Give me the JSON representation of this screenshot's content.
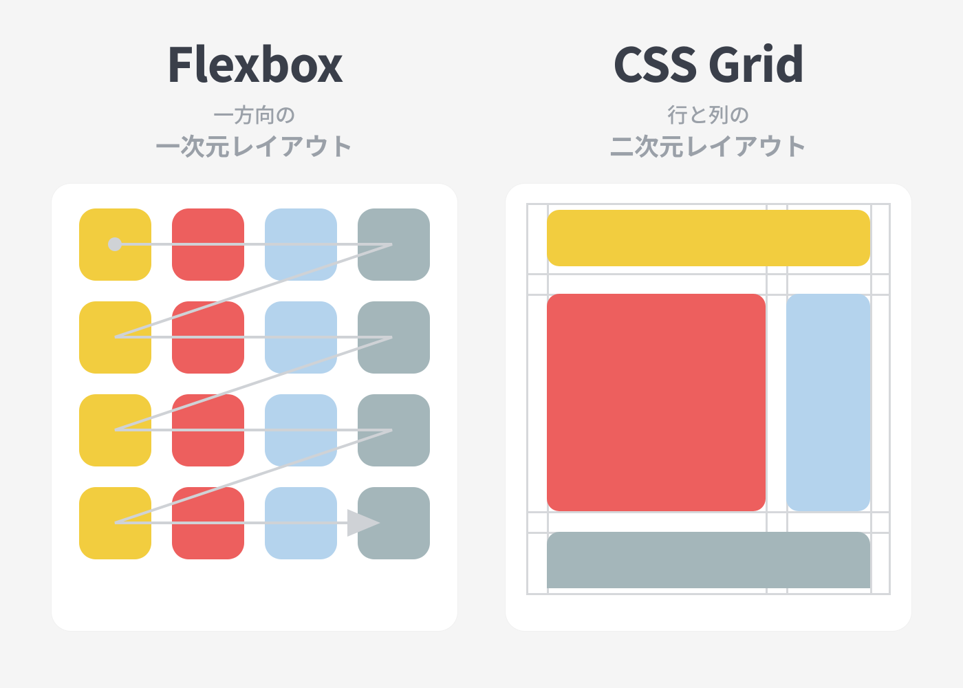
{
  "flexbox": {
    "title": "Flexbox",
    "subtitle1": "一方向の",
    "subtitle2": "一次元レイアウト",
    "rows": 4,
    "cols": 4,
    "colors": [
      "yellow",
      "red",
      "blue",
      "slate"
    ]
  },
  "grid": {
    "title": "CSS Grid",
    "subtitle1": "行と列の",
    "subtitle2": "二次元レイアウト",
    "areas": {
      "header": "yellow",
      "main": "red",
      "aside": "blue",
      "footer": "slate"
    }
  },
  "palette": {
    "yellow": "#f2cd3f",
    "red": "#ed5f5e",
    "blue": "#b4d3ed",
    "slate": "#a4b6ba",
    "line": "#cfd2d6",
    "text_dark": "#3a3f4a",
    "text_muted": "#9aa0a8"
  }
}
